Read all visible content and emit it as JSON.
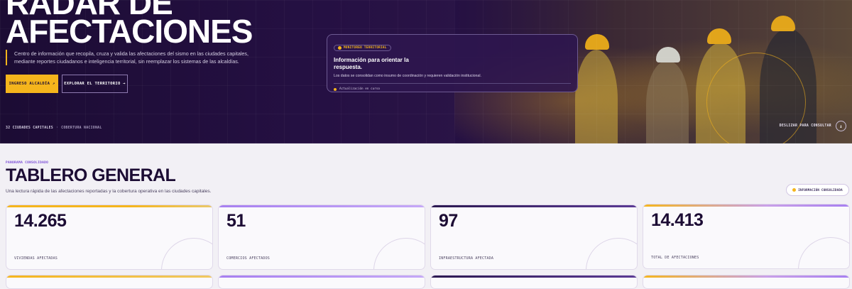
{
  "hero": {
    "title_line1": "RADAR DE",
    "title_line2": "AFECTACIONES",
    "description": "Centro de información que recopila, cruza y valida las afectaciones del sismo en las ciudades capitales, mediante reportes ciudadanos e inteligencia territorial, sin reemplazar los sistemas de las alcaldías.",
    "primary_button": "INGRESO ALCALDÍA ↗",
    "secondary_button": "EXPLORAR EL TERRITORIO →",
    "footer_cities": "32 CIUDADES CAPITALES",
    "footer_dot": "·",
    "footer_coverage": "COBERTURA NACIONAL",
    "scroll_label": "DESLIZAR PARA CONSULTAR",
    "scroll_icon": "↓"
  },
  "monitor": {
    "badge": "MONITOREO TERRITORIAL",
    "title": "Información para orientar la respuesta.",
    "text": "Los datos se consolidan como insumo de coordinación y requieren validación institucional.",
    "status": "Actualización en curso"
  },
  "dashboard": {
    "kicker": "PANORAMA CONSOLIDADO",
    "title": "TABLERO GENERAL",
    "subtitle": "Una lectura rápida de las afectaciones reportadas y la cobertura operativa en las ciudades capitales.",
    "info_pill": "INFORMACIÓN CONSOLIDADA",
    "cards": [
      {
        "value": "14.265",
        "label": "VIVIENDAS AFECTADAS",
        "accent": "#f5b51c"
      },
      {
        "value": "51",
        "label": "COMERCIOS AFECTADOS",
        "accent": "#a77ff0"
      },
      {
        "value": "97",
        "label": "INFRAESTRUCTURA AFECTADA",
        "accent": "#2b1850"
      },
      {
        "value": "14.413",
        "label": "TOTAL DE AFECTACIONES",
        "accent": "#f5b51c"
      }
    ]
  },
  "colors": {
    "brand_dark": "#1c0c34",
    "accent_yellow": "#f5b51c",
    "accent_purple": "#a77ff0"
  }
}
